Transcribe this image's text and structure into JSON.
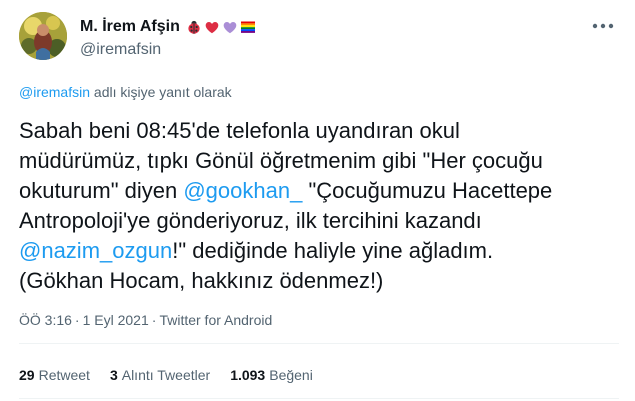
{
  "author": {
    "display_name": "M. İrem Afşin",
    "handle": "@iremafsin",
    "name_emojis": [
      "ladybug-emoji",
      "red-heart-emoji",
      "purple-heart-emoji",
      "rainbow-flag-emoji"
    ]
  },
  "reply_context": {
    "mention": "@iremafsin",
    "suffix": " adlı kişiye yanıt olarak"
  },
  "tweet": {
    "line1": "Sabah beni 08:45'de telefonla uyandıran okul",
    "line2": "müdürümüz, tıpkı Gönül öğretmenim gibi \"Her çocuğu",
    "line3_pre": "okuturum\" diyen ",
    "line3_mention": "@gookhan_",
    "line3_post": " \"Çocuğumuzu Hacettepe",
    "line4": "Antropoloji'ye gönderiyoruz, ilk tercihini kazandı",
    "line5_mention": "@nazim_ozgun",
    "line5_post": "!\" dediğinde haliyle yine ağladım.",
    "line6": "(Gökhan Hocam, hakkınız ödenmez!)"
  },
  "meta": {
    "time": "ÖÖ 3:16",
    "date": "1 Eyl 2021",
    "source": "Twitter for Android",
    "separator": "·"
  },
  "stats": {
    "retweets_count": "29",
    "retweets_label": "Retweet",
    "quotes_count": "3",
    "quotes_label": "Alıntı Tweetler",
    "likes_count": "1.093",
    "likes_label": "Beğeni"
  },
  "colors": {
    "link": "#1d9bf0",
    "secondary_text": "#536471",
    "primary_text": "#0f1419"
  },
  "icons": {
    "more_button": "more-dots-icon"
  }
}
